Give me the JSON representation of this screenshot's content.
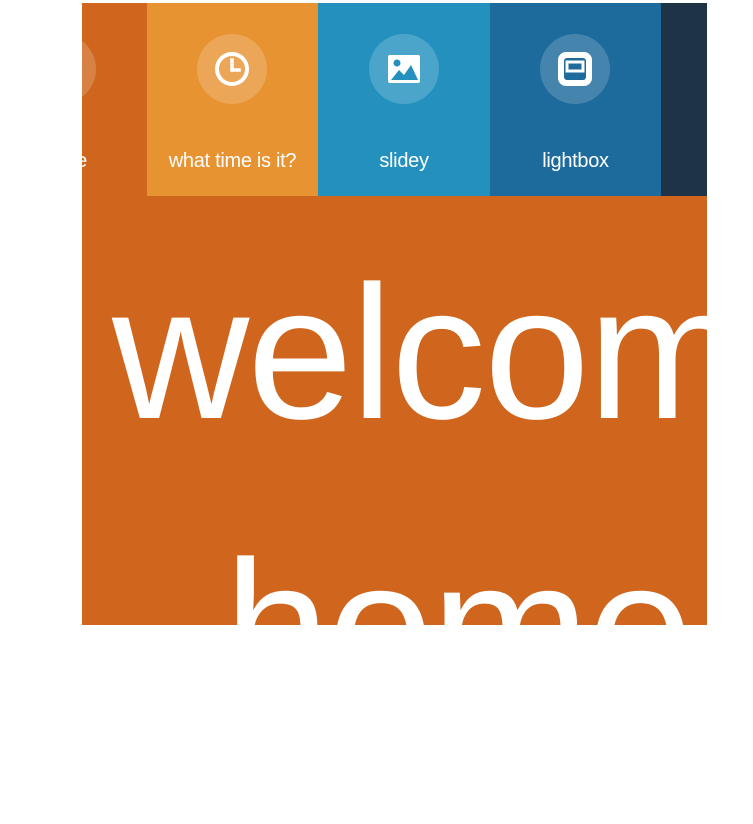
{
  "colors": {
    "page_background": "#ffffff",
    "section_background": "#d0661d",
    "tile_home": "#d0661d",
    "tile_time": "#e89332",
    "tile_slidey": "#2490be",
    "tile_lightbox": "#1d6a9c",
    "tile_more": "#1e3345",
    "text": "#ffffff"
  },
  "nav": {
    "tiles": [
      {
        "label": "e",
        "icon": "home-icon"
      },
      {
        "label": "what time is it?",
        "icon": "clock-icon"
      },
      {
        "label": "slidey",
        "icon": "image-icon"
      },
      {
        "label": "lightbox",
        "icon": "lightbox-icon"
      },
      {
        "label": "",
        "icon": ""
      }
    ]
  },
  "hero": {
    "line1": "welcome",
    "line2": "home"
  }
}
